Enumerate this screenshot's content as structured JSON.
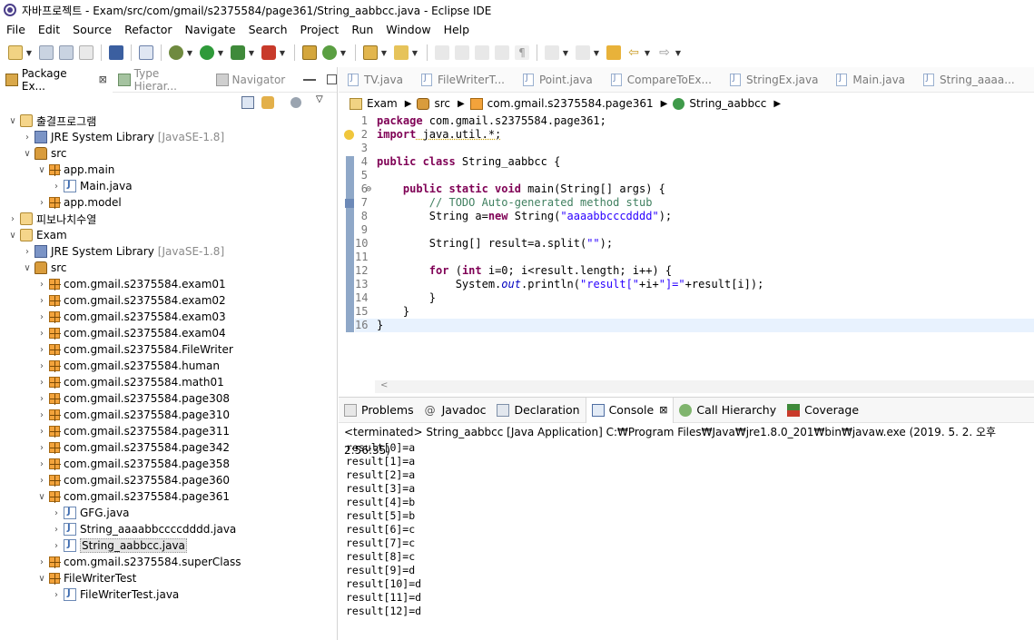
{
  "window": {
    "title": "자바프로젝트 - Exam/src/com/gmail/s2375584/page361/String_aabbcc.java - Eclipse IDE"
  },
  "menu": [
    "File",
    "Edit",
    "Source",
    "Refactor",
    "Navigate",
    "Search",
    "Project",
    "Run",
    "Window",
    "Help"
  ],
  "left_tabs": [
    {
      "label": "Package Ex...",
      "close": "⊠"
    },
    {
      "label": "Type Hierar..."
    },
    {
      "label": "Navigator"
    }
  ],
  "tree": [
    {
      "level": 0,
      "twisty": "∨",
      "icon": "proj",
      "label": "출결프로그램"
    },
    {
      "level": 1,
      "twisty": "›",
      "icon": "jre",
      "label": "JRE System Library",
      "tag": "[JavaSE-1.8]"
    },
    {
      "level": 1,
      "twisty": "∨",
      "icon": "src",
      "label": "src"
    },
    {
      "level": 2,
      "twisty": "∨",
      "icon": "pkg",
      "label": "app.main"
    },
    {
      "level": 3,
      "twisty": "›",
      "icon": "jfile",
      "label": "Main.java"
    },
    {
      "level": 2,
      "twisty": "›",
      "icon": "pkg",
      "label": "app.model"
    },
    {
      "level": 0,
      "twisty": "›",
      "icon": "proj",
      "label": "피보나치수열"
    },
    {
      "level": 0,
      "twisty": "∨",
      "icon": "proj",
      "label": "Exam"
    },
    {
      "level": 1,
      "twisty": "›",
      "icon": "jre",
      "label": "JRE System Library",
      "tag": "[JavaSE-1.8]"
    },
    {
      "level": 1,
      "twisty": "∨",
      "icon": "src",
      "label": "src"
    },
    {
      "level": 2,
      "twisty": "›",
      "icon": "pkg",
      "label": "com.gmail.s2375584.exam01"
    },
    {
      "level": 2,
      "twisty": "›",
      "icon": "pkg",
      "label": "com.gmail.s2375584.exam02"
    },
    {
      "level": 2,
      "twisty": "›",
      "icon": "pkg",
      "label": "com.gmail.s2375584.exam03"
    },
    {
      "level": 2,
      "twisty": "›",
      "icon": "pkg",
      "label": "com.gmail.s2375584.exam04"
    },
    {
      "level": 2,
      "twisty": "›",
      "icon": "pkg",
      "label": "com.gmail.s2375584.FileWriter"
    },
    {
      "level": 2,
      "twisty": "›",
      "icon": "pkg",
      "label": "com.gmail.s2375584.human"
    },
    {
      "level": 2,
      "twisty": "›",
      "icon": "pkg",
      "label": "com.gmail.s2375584.math01"
    },
    {
      "level": 2,
      "twisty": "›",
      "icon": "pkg",
      "label": "com.gmail.s2375584.page308"
    },
    {
      "level": 2,
      "twisty": "›",
      "icon": "pkg",
      "label": "com.gmail.s2375584.page310"
    },
    {
      "level": 2,
      "twisty": "›",
      "icon": "pkg",
      "label": "com.gmail.s2375584.page311"
    },
    {
      "level": 2,
      "twisty": "›",
      "icon": "pkg",
      "label": "com.gmail.s2375584.page342"
    },
    {
      "level": 2,
      "twisty": "›",
      "icon": "pkg",
      "label": "com.gmail.s2375584.page358"
    },
    {
      "level": 2,
      "twisty": "›",
      "icon": "pkg",
      "label": "com.gmail.s2375584.page360"
    },
    {
      "level": 2,
      "twisty": "∨",
      "icon": "pkg",
      "label": "com.gmail.s2375584.page361"
    },
    {
      "level": 3,
      "twisty": "›",
      "icon": "jfile",
      "label": "GFG.java"
    },
    {
      "level": 3,
      "twisty": "›",
      "icon": "jfile",
      "label": "String_aaaabbccccdddd.java"
    },
    {
      "level": 3,
      "twisty": "›",
      "icon": "jfile",
      "label": "String_aabbcc.java",
      "selected": true
    },
    {
      "level": 2,
      "twisty": "›",
      "icon": "pkg",
      "label": "com.gmail.s2375584.superClass"
    },
    {
      "level": 2,
      "twisty": "∨",
      "icon": "pkg",
      "label": "FileWriterTest"
    },
    {
      "level": 3,
      "twisty": "›",
      "icon": "jfile",
      "label": "FileWriterTest.java"
    }
  ],
  "editor_tabs": [
    "TV.java",
    "FileWriterT...",
    "Point.java",
    "CompareToEx...",
    "StringEx.java",
    "Main.java",
    "String_aaaa..."
  ],
  "breadcrumb": [
    "Exam",
    "src",
    "com.gmail.s2375584.page361",
    "String_aabbcc"
  ],
  "code_lines": [
    "1",
    "2",
    "3",
    "4",
    "5",
    "6",
    "7",
    "8",
    "9",
    "10",
    "11",
    "12",
    "13",
    "14",
    "15",
    "16"
  ],
  "code": {
    "l1_kw": "package",
    "l1_rest": " com.gmail.s2375584.page361;",
    "l2_kw": "import",
    "l2_rest": " java.util.*;",
    "l4_kw": "public class",
    "l4_rest": " String_aabbcc {",
    "l6_kw": "public static void",
    "l6_rest": " main(String[] args) {",
    "l7": "// TODO Auto-generated method stub",
    "l8_a": "String a=",
    "l8_kw": "new",
    "l8_b": " String(",
    "l8_str": "\"aaaabbcccdddd\"",
    "l8_c": ");",
    "l10_a": "String[] result=a.split(",
    "l10_str": "\"\"",
    "l10_b": ");",
    "l12_kw": "for",
    "l12_a": " (",
    "l12_kw2": "int",
    "l12_b": " i=0; i<result.length; i++) {",
    "l13_a": "System.",
    "l13_fld": "out",
    "l13_b": ".println(",
    "l13_str1": "\"result[\"",
    "l13_c": "+i+",
    "l13_str2": "\"]=\"",
    "l13_d": "+result[i]);",
    "l14": "}",
    "l15": "}",
    "l16": "}"
  },
  "bottom_tabs": [
    {
      "label": "Problems"
    },
    {
      "label": "Javadoc"
    },
    {
      "label": "Declaration"
    },
    {
      "label": "Console",
      "close": "⊠"
    },
    {
      "label": "Call Hierarchy"
    },
    {
      "label": "Coverage"
    }
  ],
  "console": {
    "header": "<terminated> String_aabbcc [Java Application] C:₩Program Files₩Java₩jre1.8.0_201₩bin₩javaw.exe (2019. 5. 2. 오후 2:56:35)",
    "lines": [
      "result[0]=a",
      "result[1]=a",
      "result[2]=a",
      "result[3]=a",
      "result[4]=b",
      "result[5]=b",
      "result[6]=c",
      "result[7]=c",
      "result[8]=c",
      "result[9]=d",
      "result[10]=d",
      "result[11]=d",
      "result[12]=d"
    ]
  }
}
